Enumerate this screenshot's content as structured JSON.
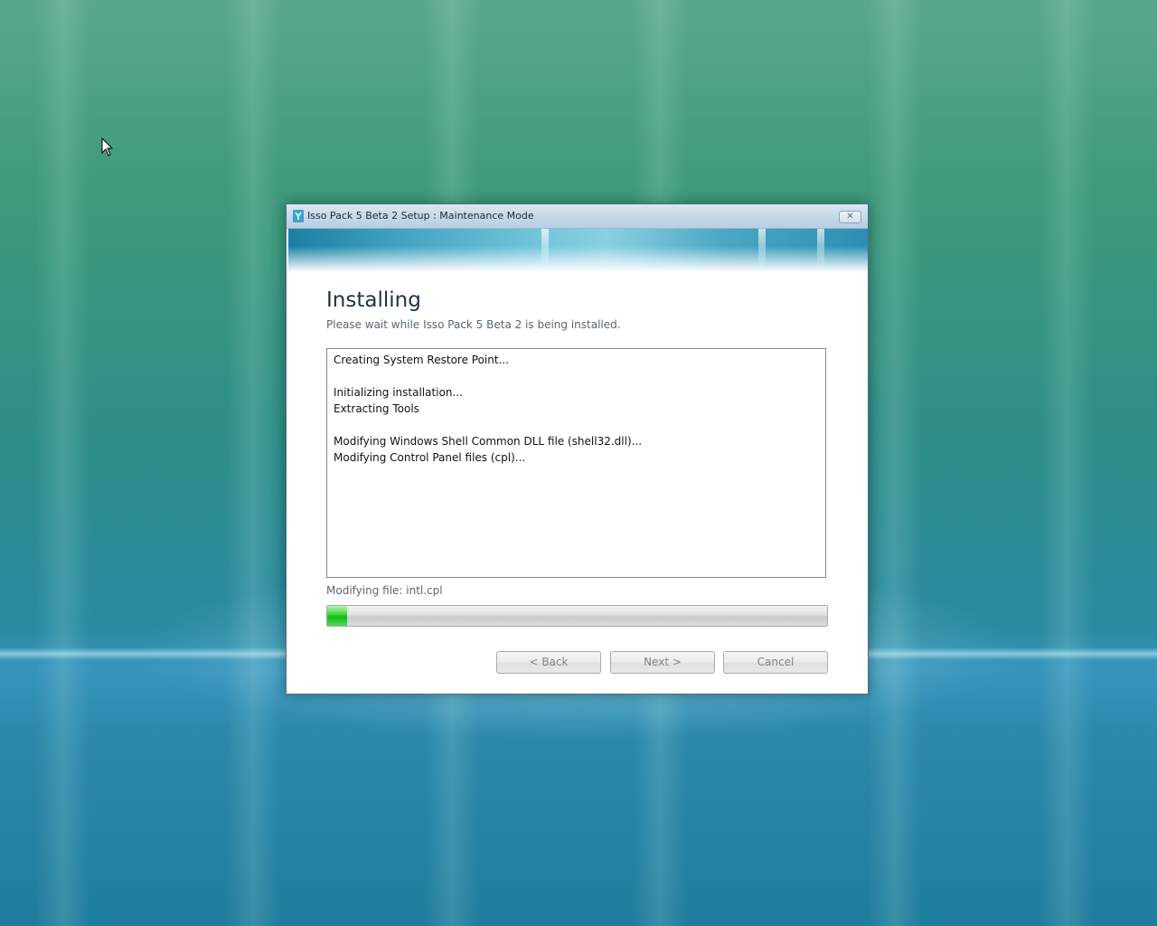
{
  "window": {
    "title": "Isso Pack 5 Beta 2 Setup : Maintenance Mode",
    "close_icon": "close-icon"
  },
  "page": {
    "heading": "Installing",
    "subheading": "Please wait while Isso Pack 5 Beta 2 is being installed."
  },
  "log": {
    "lines": [
      "Creating System Restore Point...",
      "",
      "Initializing installation...",
      "Extracting Tools",
      "",
      "Modifying Windows Shell Common DLL file (shell32.dll)...",
      "Modifying Control Panel files (cpl)..."
    ]
  },
  "status": {
    "text": "Modifying file: intl.cpl"
  },
  "progress": {
    "fraction": 0.04
  },
  "buttons": {
    "back_label": "< Back",
    "next_label": "Next >",
    "cancel_label": "Cancel"
  },
  "colors": {
    "progress_fill": "#2fcf33",
    "title_bar": "#c6dae9"
  }
}
